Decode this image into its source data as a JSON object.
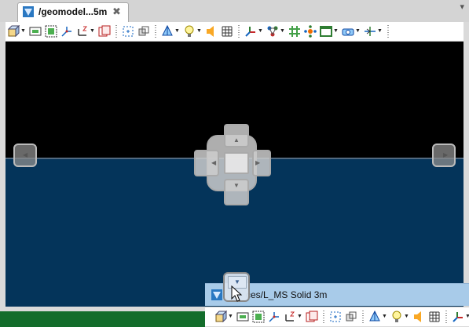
{
  "editor_tab": {
    "title": "/geomodel...5m",
    "close": "✖",
    "view_menu": "▾"
  },
  "toolbar": {
    "tools": [
      {
        "icon": "cube-view-icon",
        "dropdown": true
      },
      {
        "icon": "frame-green-icon",
        "dropdown": false
      },
      {
        "icon": "fit-green-icon",
        "dropdown": false
      },
      {
        "icon": "axis-xyz-icon",
        "dropdown": false
      },
      {
        "icon": "z-axis-icon",
        "dropdown": true
      },
      {
        "icon": "copy-pages-icon",
        "dropdown": false
      },
      {
        "sep": true
      },
      {
        "icon": "select-box-icon",
        "dropdown": false
      },
      {
        "icon": "transform-icon",
        "dropdown": false
      },
      {
        "sep": true
      },
      {
        "icon": "pyramid-icon",
        "dropdown": true
      },
      {
        "icon": "bulb-icon",
        "dropdown": true
      },
      {
        "icon": "speaker-icon",
        "dropdown": false
      },
      {
        "icon": "grid-icon",
        "dropdown": false
      },
      {
        "sep": true
      },
      {
        "icon": "axis-colored-icon",
        "dropdown": true
      },
      {
        "icon": "node-graph-icon",
        "dropdown": true
      },
      {
        "icon": "lattice-icon",
        "dropdown": false
      },
      {
        "icon": "atom-icon",
        "dropdown": false
      },
      {
        "icon": "window-green-icon",
        "dropdown": true
      },
      {
        "icon": "camera-icon",
        "dropdown": true
      },
      {
        "icon": "cursor-lines-icon",
        "dropdown": true
      },
      {
        "sep": true
      }
    ]
  },
  "sub_window": {
    "title_visible": "ces/L_MS Solid 3m"
  },
  "colors": {
    "sky": "#000000",
    "ground": "#04345a",
    "horizon": "#526a80",
    "subbar": "#a8cbe9",
    "taskbar": "#136d2b"
  }
}
